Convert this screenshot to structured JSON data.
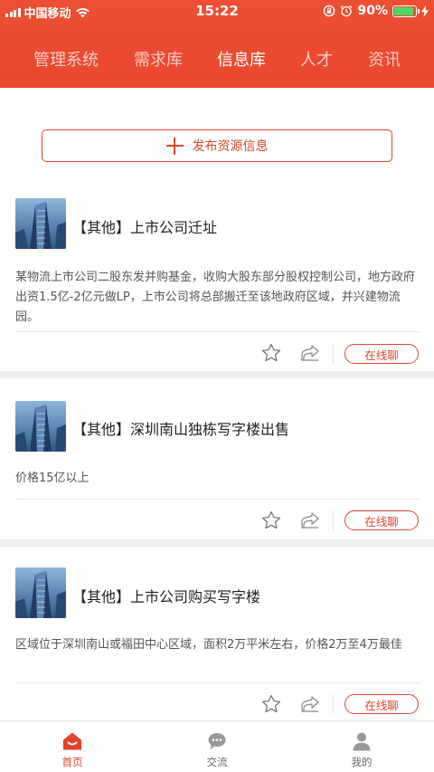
{
  "status_bar": {
    "carrier": "中国移动",
    "time": "15:22",
    "battery": "90%",
    "battery_level": 0.9
  },
  "tabs": [
    {
      "label": "管理系统",
      "active": false
    },
    {
      "label": "需求库",
      "active": false
    },
    {
      "label": "信息库",
      "active": true
    },
    {
      "label": "人才",
      "active": false
    },
    {
      "label": "资讯",
      "active": false
    }
  ],
  "publish_button": {
    "label": "发布资源信息",
    "icon": "plus-icon"
  },
  "cards": [
    {
      "title": "【其他】上市公司迁址",
      "description": "某物流上市公司二股东发并购基金，收购大股东部分股权控制公司，地方政府出资1.5亿-2亿元做LP，上市公司将总部搬迁至该地政府区域，并兴建物流园。",
      "chat_label": "在线聊"
    },
    {
      "title": "【其他】深圳南山独栋写字楼出售",
      "description": "价格15亿以上",
      "chat_label": "在线聊"
    },
    {
      "title": "【其他】上市公司购买写字楼",
      "description": "区域位于深圳南山或福田中心区域，面积2万平米左右，价格2万至4万最佳",
      "chat_label": "在线聊"
    }
  ],
  "bottom_nav": [
    {
      "label": "首页",
      "icon": "home-icon",
      "active": true
    },
    {
      "label": "交流",
      "icon": "chat-bubble-icon",
      "active": false
    },
    {
      "label": "我的",
      "icon": "user-icon",
      "active": false
    }
  ],
  "colors": {
    "brand": "#e8482e",
    "accent_text": "#d8462e",
    "battery_fill": "#4cd964"
  }
}
